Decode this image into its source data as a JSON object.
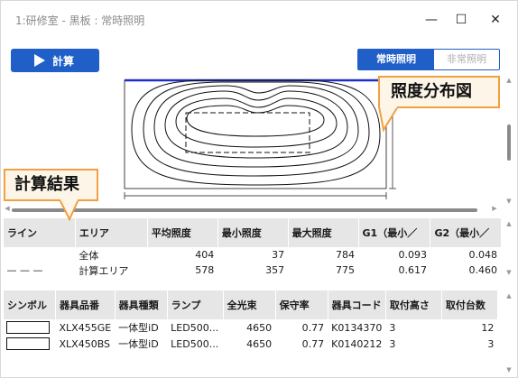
{
  "window": {
    "title": "1:研修室 - 黒板 : 常時照明",
    "minimize_glyph": "—",
    "maximize_glyph": "☐",
    "close_glyph": "✕"
  },
  "toolbar": {
    "run_label": "計算",
    "mode_on_label": "常時照明",
    "mode_off_label": "非常照明",
    "accent_color": "#1f5fc7"
  },
  "callouts": {
    "map_label": "照度分布図",
    "results_label": "計算結果",
    "color": "#f0a040"
  },
  "results_table": {
    "headers": [
      "ライン",
      "エリア",
      "平均照度",
      "最小照度",
      "最大照度",
      "G1（最小／",
      "G2（最小／"
    ],
    "rows": [
      {
        "line": "",
        "area": "全体",
        "avg": "404",
        "min": "37",
        "max": "784",
        "g1": "0.093",
        "g2": "0.048"
      },
      {
        "line": "— — —",
        "area": "計算エリア",
        "avg": "578",
        "min": "357",
        "max": "775",
        "g1": "0.617",
        "g2": "0.460"
      }
    ]
  },
  "fixture_table": {
    "headers": [
      "シンボル",
      "器具品番",
      "器具種類",
      "ランプ",
      "全光束",
      "保守率",
      "器具コード",
      "取付高さ",
      "取付台数"
    ],
    "rows": [
      {
        "model": "XLX455GE",
        "kind": "一体型iD",
        "lamp": "LED500...",
        "flux": "4650",
        "mf": "0.77",
        "code": "K0134370",
        "height": "3",
        "count": "12"
      },
      {
        "model": "XLX450BS",
        "kind": "一体型iD",
        "lamp": "LED500...",
        "flux": "4650",
        "mf": "0.77",
        "code": "K0140212",
        "height": "3",
        "count": "3"
      }
    ]
  }
}
